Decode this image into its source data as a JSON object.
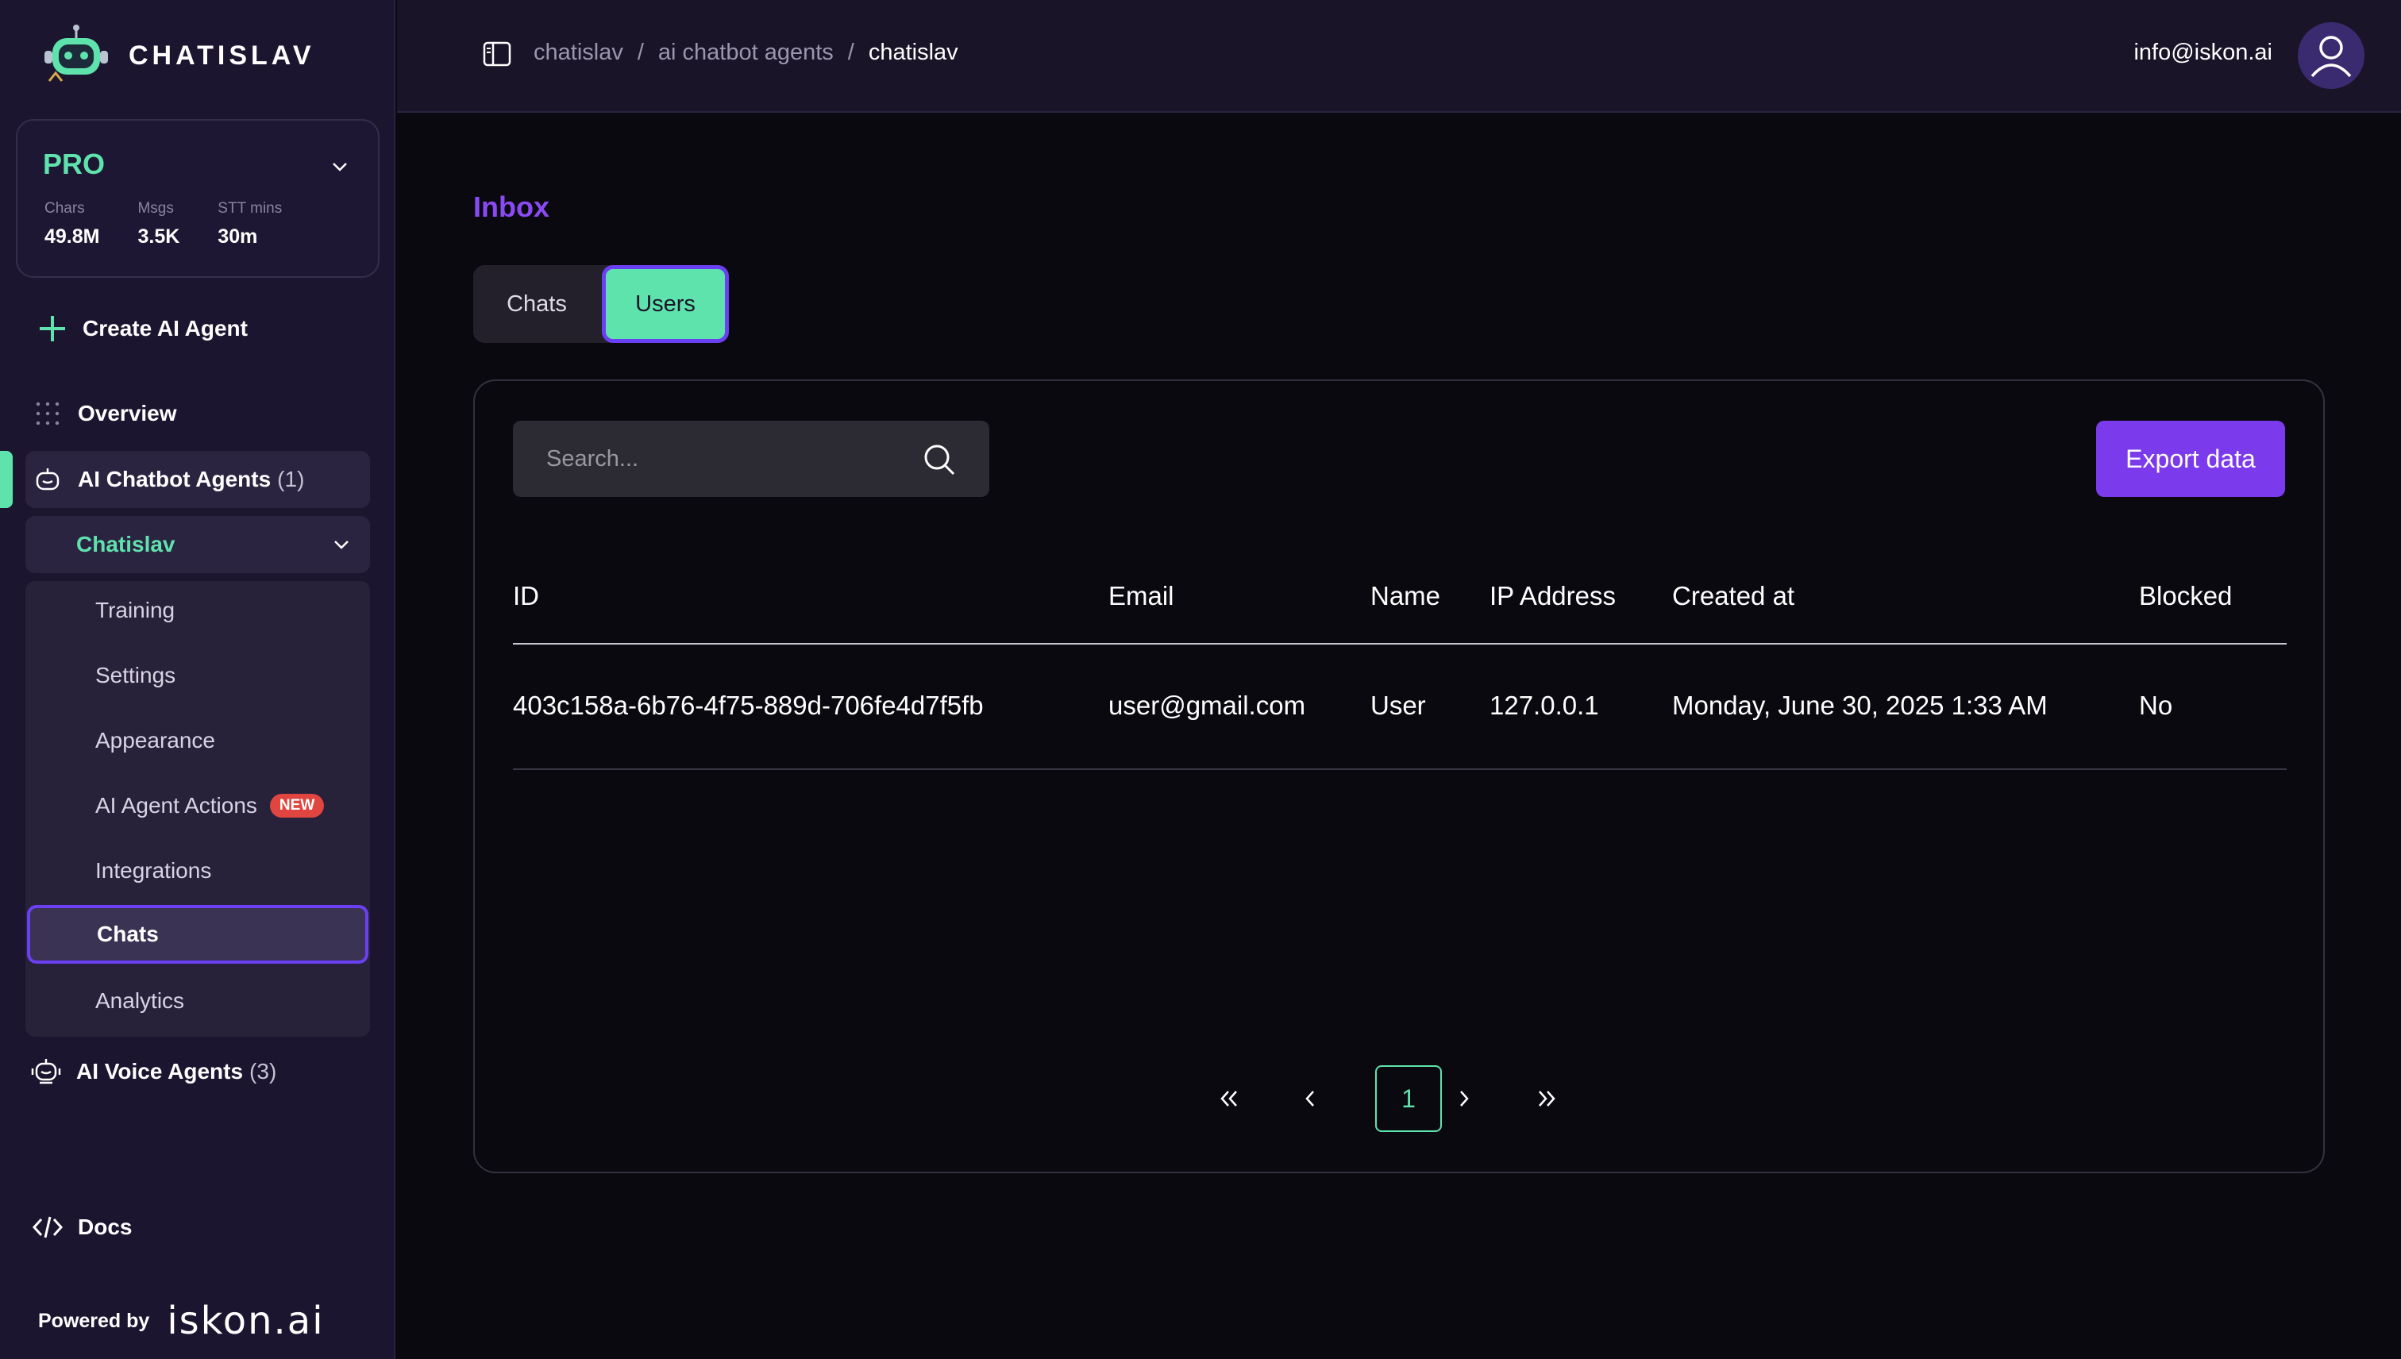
{
  "brand": {
    "name": "CHATISLAV"
  },
  "plan": {
    "name": "PRO",
    "stats": [
      {
        "label": "Chars",
        "value": "49.8M"
      },
      {
        "label": "Msgs",
        "value": "3.5K"
      },
      {
        "label": "STT mins",
        "value": "30m"
      }
    ]
  },
  "sidebar": {
    "create_agent": "Create AI Agent",
    "overview": "Overview",
    "chatbot_agents": {
      "label": "AI Chatbot Agents",
      "count": "(1)"
    },
    "agent_name": "Chatislav",
    "sub_items": {
      "training": "Training",
      "settings": "Settings",
      "appearance": "Appearance",
      "actions": "AI Agent Actions",
      "actions_badge": "NEW",
      "integrations": "Integrations",
      "chats": "Chats",
      "analytics": "Analytics"
    },
    "voice_agents": {
      "label": "AI Voice Agents",
      "count": "(3)"
    },
    "docs": "Docs",
    "powered_by": "Powered by",
    "powered_logo": "iskon.ai"
  },
  "topbar": {
    "breadcrumb": [
      "chatislav",
      "ai chatbot agents",
      "chatislav"
    ],
    "separator": "/",
    "user_email": "info@iskon.ai"
  },
  "main": {
    "title": "Inbox",
    "tabs": {
      "chats": "Chats",
      "users": "Users"
    },
    "search_placeholder": "Search...",
    "export_label": "Export data",
    "table": {
      "headers": {
        "id": "ID",
        "email": "Email",
        "name": "Name",
        "ip": "IP Address",
        "created": "Created at",
        "blocked": "Blocked"
      },
      "rows": [
        {
          "id": "403c158a-6b76-4f75-889d-706fe4d7f5fb",
          "email": "user@gmail.com",
          "name": "User",
          "ip": "127.0.0.1",
          "created": "Monday, June 30, 2025 1:33 AM",
          "blocked": "No"
        }
      ]
    },
    "pagination": {
      "current_page": "1"
    }
  },
  "colors": {
    "accent_green": "#5fe3ad",
    "accent_purple": "#7c3aed",
    "badge_red": "#e0463f"
  }
}
